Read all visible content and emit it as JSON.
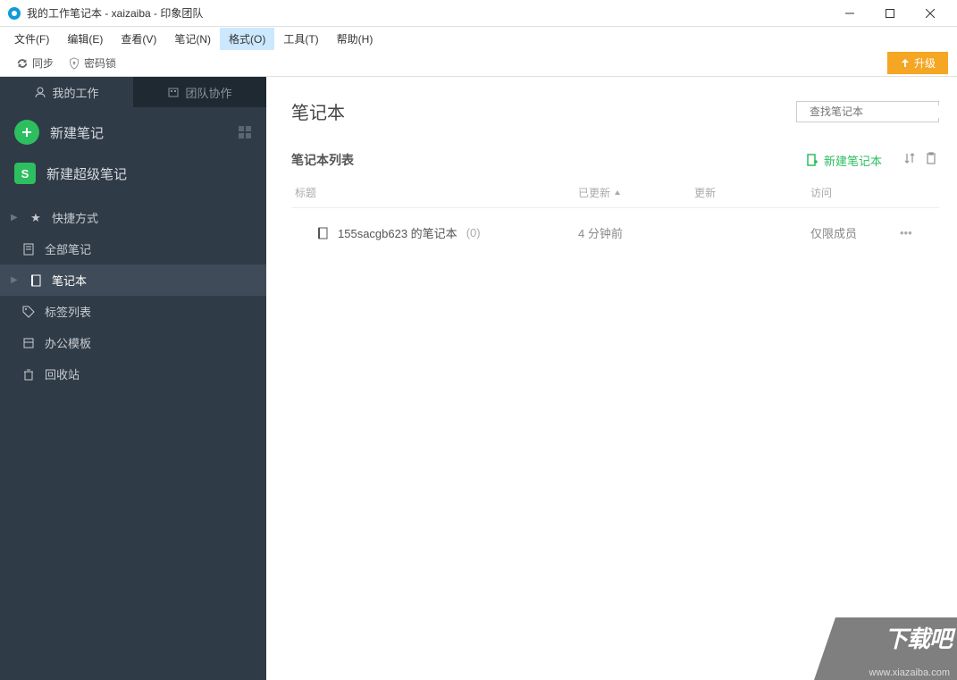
{
  "window": {
    "title": "我的工作笔记本 - xaizaiba - 印象团队"
  },
  "menu": {
    "file": "文件(F)",
    "edit": "编辑(E)",
    "view": "查看(V)",
    "note": "笔记(N)",
    "format": "格式(O)",
    "tools": "工具(T)",
    "help": "帮助(H)"
  },
  "toolbar": {
    "sync": "同步",
    "lock": "密码锁",
    "upgrade": "升级"
  },
  "sidebar": {
    "tab_work": "我的工作",
    "tab_team": "团队协作",
    "new_note": "新建笔记",
    "new_super": "新建超级笔记",
    "items": {
      "shortcut": "快捷方式",
      "all_notes": "全部笔记",
      "notebooks": "笔记本",
      "tags": "标签列表",
      "templates": "办公模板",
      "trash": "回收站"
    }
  },
  "main": {
    "title": "笔记本",
    "search_placeholder": "查找笔记本",
    "list_title": "笔记本列表",
    "new_notebook": "新建笔记本",
    "cols": {
      "title": "标题",
      "updated": "已更新",
      "update": "更新",
      "access": "访问"
    },
    "row": {
      "name": "155sacgb623 的笔记本",
      "count": "(0)",
      "updated": "4 分钟前",
      "access": "仅限成员"
    }
  },
  "watermark": {
    "big": "下载吧",
    "url": "www.xiazaiba.com"
  }
}
